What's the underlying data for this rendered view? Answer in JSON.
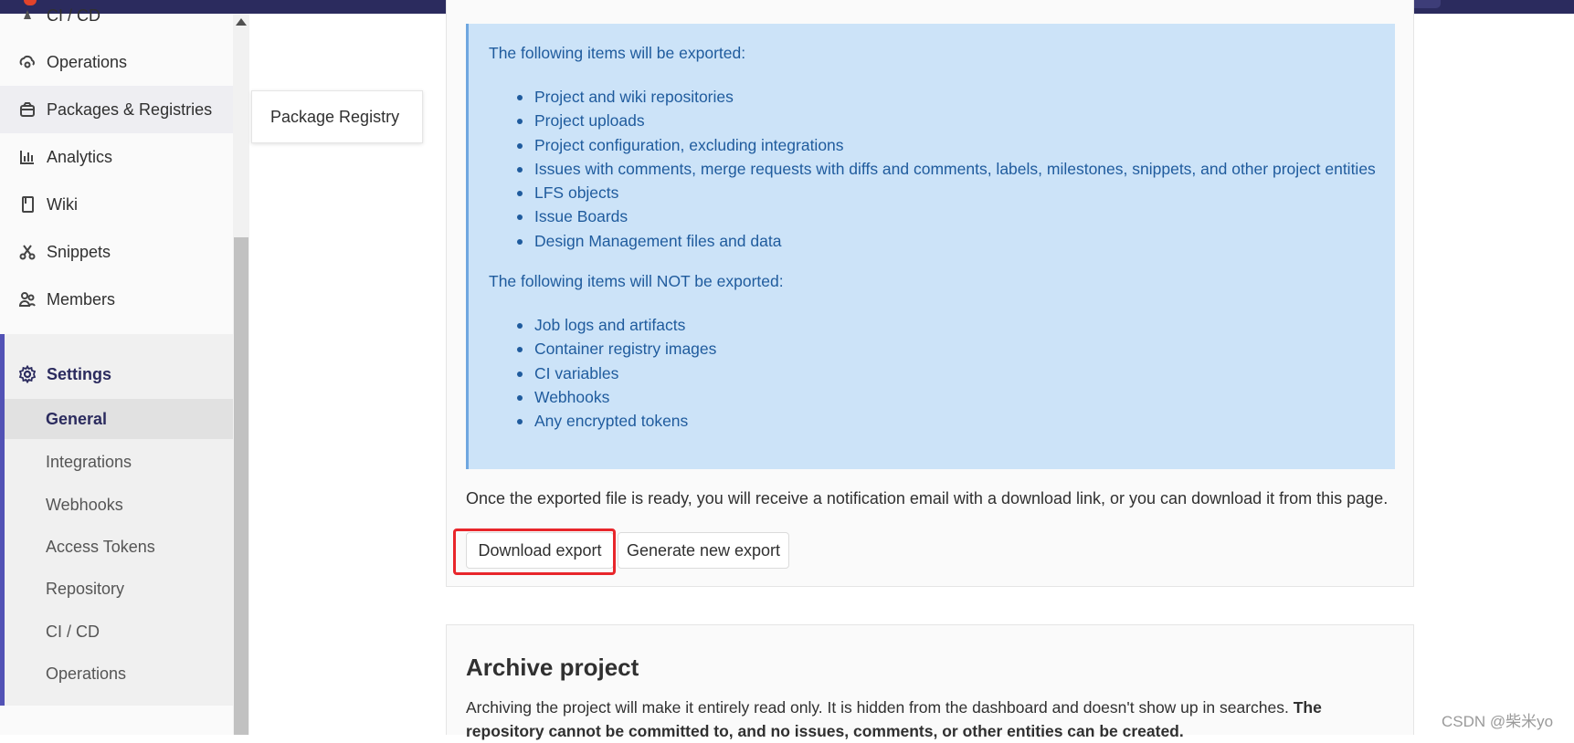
{
  "sidebar": {
    "cutoff_label": "CI / CD",
    "items": [
      {
        "label": "Operations",
        "icon": "cloud-gear-icon"
      },
      {
        "label": "Packages & Registries",
        "icon": "package-icon"
      },
      {
        "label": "Analytics",
        "icon": "chart-icon"
      },
      {
        "label": "Wiki",
        "icon": "book-icon"
      },
      {
        "label": "Snippets",
        "icon": "scissors-icon"
      },
      {
        "label": "Members",
        "icon": "users-icon"
      },
      {
        "label": "Settings",
        "icon": "gear-icon"
      }
    ],
    "settings_subitems": [
      "General",
      "Integrations",
      "Webhooks",
      "Access Tokens",
      "Repository",
      "CI / CD",
      "Operations"
    ],
    "active_subitem": "General"
  },
  "flyout": {
    "label": "Package Registry"
  },
  "export": {
    "included_heading": "The following items will be exported:",
    "included_items": [
      "Project and wiki repositories",
      "Project uploads",
      "Project configuration, excluding integrations",
      "Issues with comments, merge requests with diffs and comments, labels, milestones, snippets, and other project entities",
      "LFS objects",
      "Issue Boards",
      "Design Management files and data"
    ],
    "excluded_heading": "The following items will NOT be exported:",
    "excluded_items": [
      "Job logs and artifacts",
      "Container registry images",
      "CI variables",
      "Webhooks",
      "Any encrypted tokens"
    ],
    "notice": "Once the exported file is ready, you will receive a notification email with a download link, or you can download it from this page.",
    "download_button": "Download export",
    "generate_button": "Generate new export"
  },
  "archive": {
    "title": "Archive project",
    "desc_plain": "Archiving the project will make it entirely read only. It is hidden from the dashboard and doesn't show up in searches. ",
    "desc_bold": "The repository cannot be committed to, and no issues, comments, or other entities can be created."
  },
  "watermark": "CSDN @柴米yo",
  "colors": {
    "navbar": "#2b2b5e",
    "info_bg": "#cce3f8",
    "info_text": "#1f5b9d",
    "settings_accent": "#5252b5",
    "highlight_red": "#e8262b"
  }
}
